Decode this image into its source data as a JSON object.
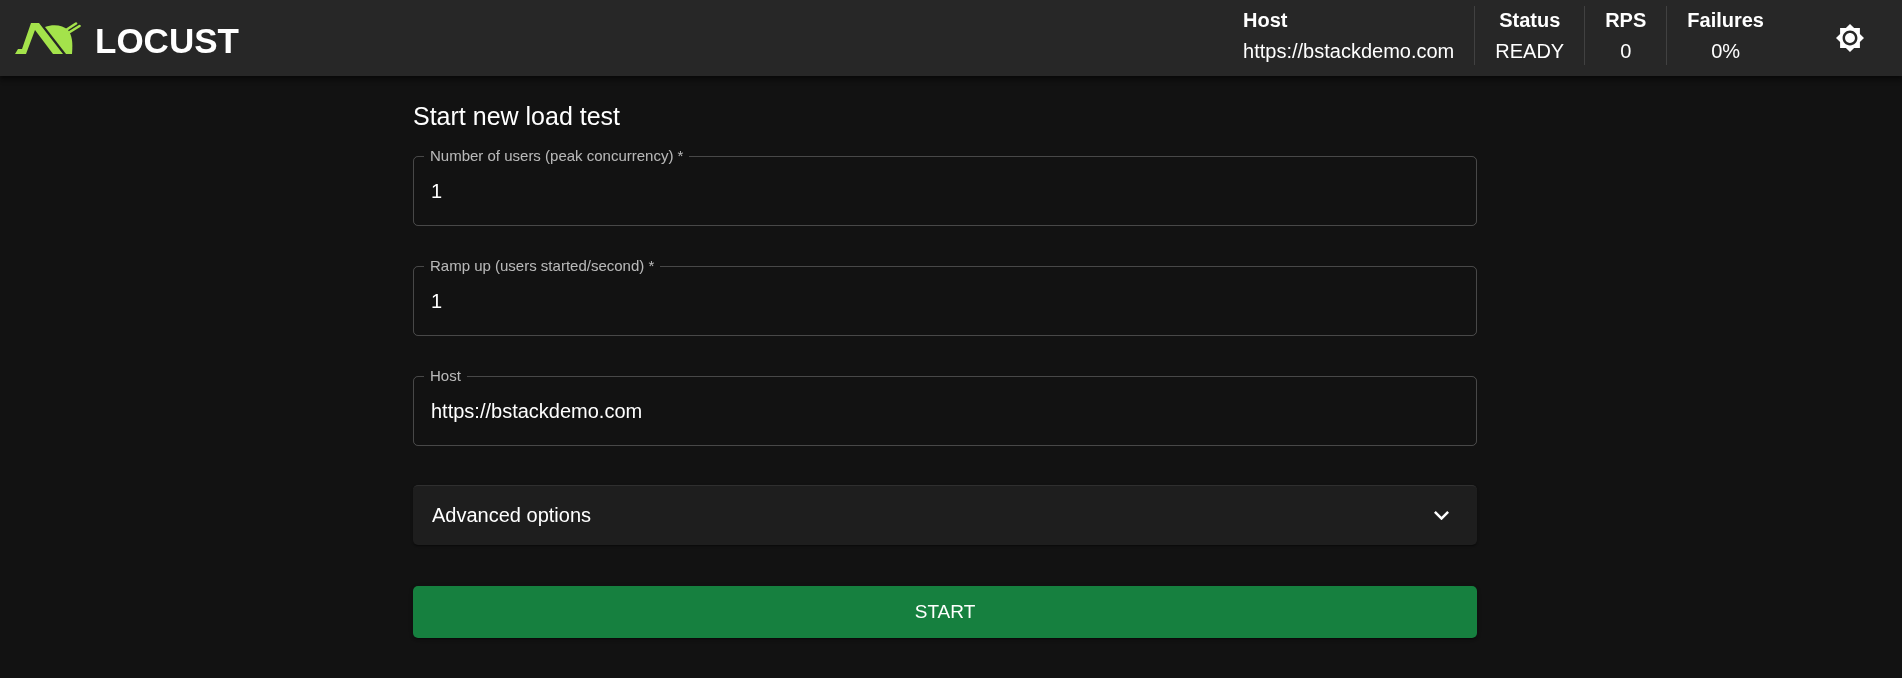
{
  "header": {
    "logo": {
      "text": "LOCUST"
    },
    "stats": [
      {
        "label": "Host",
        "value": "https://bstackdemo.com"
      },
      {
        "label": "Status",
        "value": "READY"
      },
      {
        "label": "RPS",
        "value": "0"
      },
      {
        "label": "Failures",
        "value": "0%"
      }
    ]
  },
  "form": {
    "title": "Start new load test",
    "fields": [
      {
        "label": "Number of users (peak concurrency) *",
        "value": "1"
      },
      {
        "label": "Ramp up (users started/second) *",
        "value": "1"
      },
      {
        "label": "Host",
        "value": "https://bstackdemo.com"
      }
    ],
    "advanced_options": {
      "label": "Advanced options",
      "expanded": false
    },
    "start_button": {
      "label": "START"
    }
  }
}
